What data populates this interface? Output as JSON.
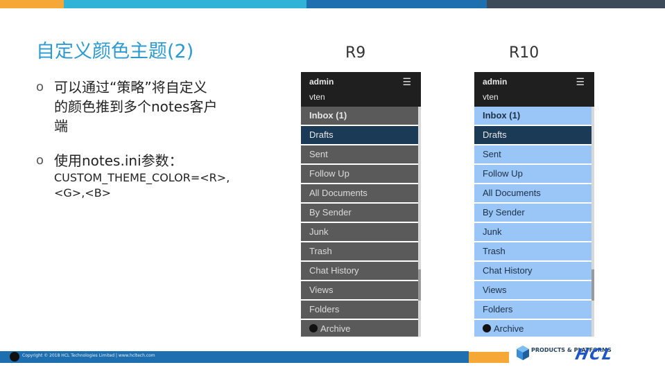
{
  "slide": {
    "title": "自定义颜色主题(2)",
    "bullets": [
      {
        "text": "可以通过“策略”将自定义\n的颜色推到多个notes客户\n端"
      },
      {
        "text": "使用notes.ini参数："
      }
    ],
    "parameter": "CUSTOM_THEME_COLOR=<R>,\n<G>,<B>"
  },
  "columns": {
    "left_label": "R9",
    "right_label": "R10"
  },
  "panel_r9": {
    "user": "admin",
    "server": "vten",
    "items": [
      "Inbox (1)",
      "Drafts",
      "Sent",
      "Follow Up",
      "All Documents",
      "By Sender",
      "Junk",
      "Trash",
      "Chat History",
      "Views",
      "Folders",
      "Archive"
    ]
  },
  "panel_r10": {
    "user": "admin",
    "server": "vten",
    "items": [
      "Inbox (1)",
      "Drafts",
      "Sent",
      "Follow Up",
      "All Documents",
      "By Sender",
      "Junk",
      "Trash",
      "Chat History",
      "Views",
      "Folders",
      "Archive"
    ]
  },
  "footer": {
    "copyright": "Copyright © 2018 HCL Technologies Limited | www.hcltech.com",
    "pp_logo": "PRODUCTS & PLATFORMS",
    "hcl_logo": "HCL"
  },
  "colors": {
    "r9_header": "#1f1f1f",
    "r9_item": "#5a5a5a",
    "r9_selected": "#1a3a56",
    "r9_text": "#e8e8e8",
    "r10_header": "#1f1f1f",
    "r10_item": "#99c6f7",
    "r10_selected": "#1a3a56",
    "r10_text": "#1c2f45",
    "accent_blue": "#2c9ad1",
    "orange": "#f6a837"
  }
}
